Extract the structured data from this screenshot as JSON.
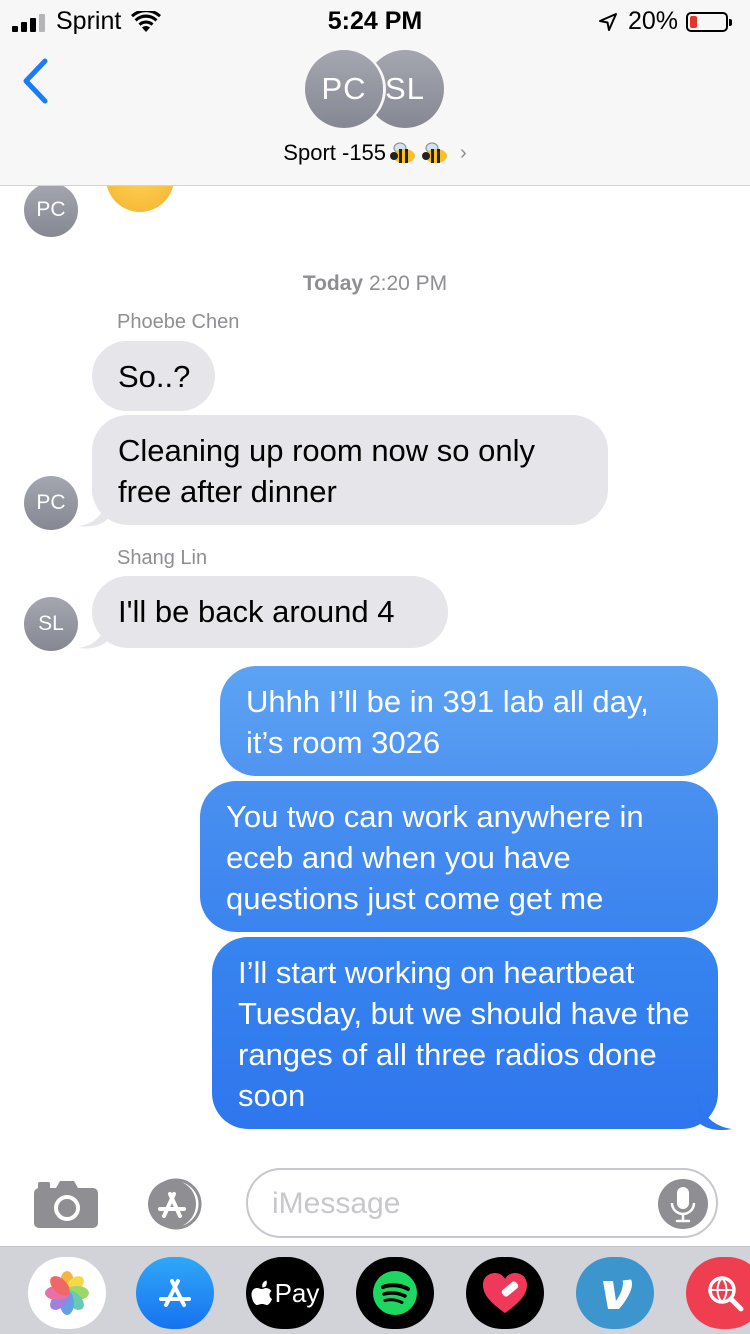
{
  "status_bar": {
    "carrier": "Sprint",
    "time": "5:24 PM",
    "battery_percent": "20%",
    "battery_level": 0.2
  },
  "header": {
    "back_icon": "chevron-left-icon",
    "participants": [
      {
        "initials": "PC"
      },
      {
        "initials": "SL"
      }
    ],
    "group_name": "Sport -155",
    "group_emoji": [
      "bee-icon",
      "bee-icon"
    ],
    "details_chevron": "›"
  },
  "thread": {
    "top_avatar_initials": "PC",
    "timestamp_day": "Today",
    "timestamp_time": "2:20 PM",
    "groups": [
      {
        "sender": "Phoebe Chen",
        "avatar_initials": "PC",
        "messages": [
          "So..?",
          "Cleaning up room now so only free after dinner"
        ]
      },
      {
        "sender": "Shang Lin",
        "avatar_initials": "SL",
        "messages": [
          "I'll be back around 4"
        ]
      }
    ],
    "outgoing": [
      "Uhhh I’ll be in 391 lab all day, it’s room 3026",
      "You two can work anywhere in eceb and when you have questions just come get me",
      "I’ll start working on heartbeat Tuesday, but we should have the ranges of all three radios done soon"
    ]
  },
  "input_bar": {
    "camera_icon": "camera-icon",
    "apps_icon": "app-store-icon",
    "placeholder": "iMessage",
    "value": "",
    "mic_icon": "microphone-icon"
  },
  "app_drawer": {
    "apps": [
      {
        "icon": "photos-icon"
      },
      {
        "icon": "app-store-icon"
      },
      {
        "icon": "apple-pay-icon",
        "label": "Pay"
      },
      {
        "icon": "spotify-icon"
      },
      {
        "icon": "heart-sticker-icon"
      },
      {
        "icon": "venmo-icon"
      },
      {
        "icon": "web-search-icon"
      }
    ]
  },
  "colors": {
    "incoming_bubble": "#e5e5ea",
    "outgoing_top": "#5aa0f2",
    "outgoing_bottom": "#2f78f0",
    "accent_blue": "#1b7cf5",
    "avatar_gray": "#8e8e93"
  }
}
